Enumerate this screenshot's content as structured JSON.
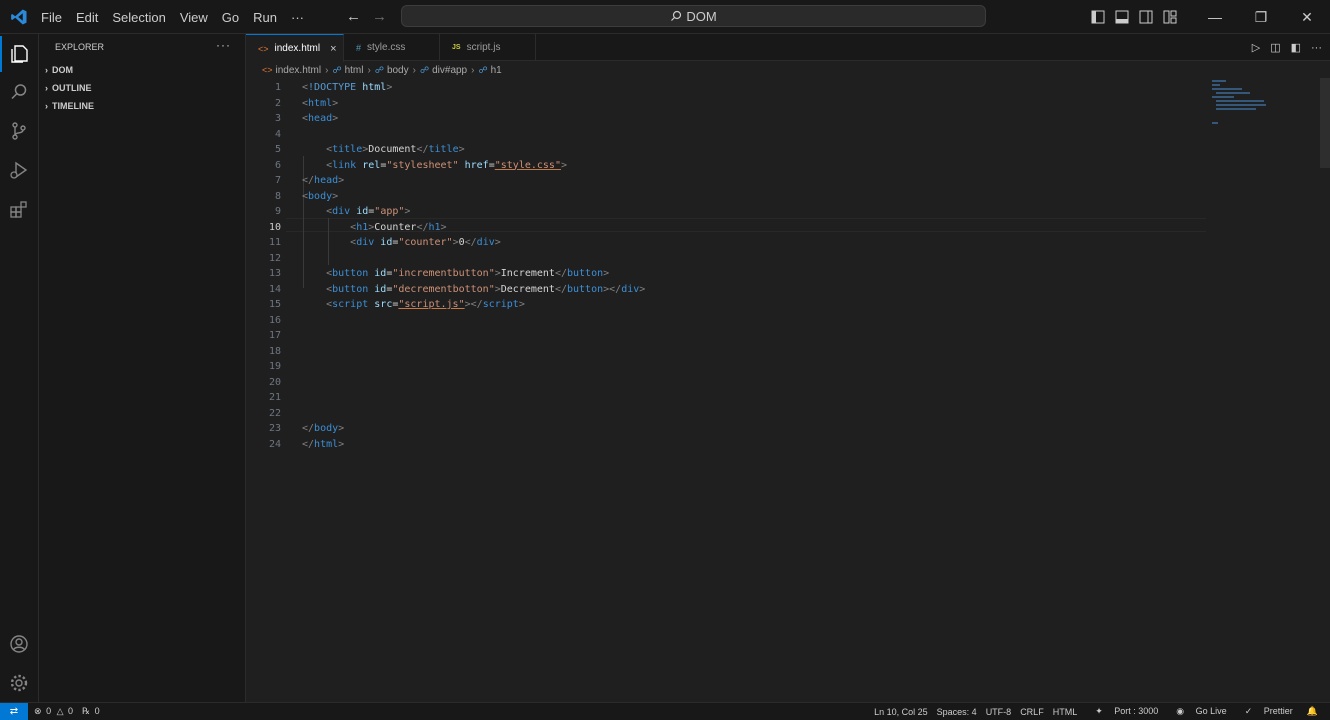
{
  "menu": [
    "File",
    "Edit",
    "Selection",
    "View",
    "Go",
    "Run",
    "···"
  ],
  "search": {
    "text": "DOM"
  },
  "sidebar": {
    "title": "EXPLORER",
    "more": "···",
    "sections": [
      "DOM",
      "OUTLINE",
      "TIMELINE"
    ]
  },
  "tabs": [
    {
      "label": "index.html",
      "icon": "<>",
      "icon_color": "#e37933"
    },
    {
      "label": "style.css",
      "icon": "#",
      "icon_color": "#519aba"
    },
    {
      "label": "script.js",
      "icon": "JS",
      "icon_color": "#cbcb41"
    }
  ],
  "tab_close": "×",
  "tab_actions": [
    "▷",
    "◫",
    "◧",
    "···"
  ],
  "breadcrumb": [
    "index.html",
    "html",
    "body",
    "div#app",
    "h1"
  ],
  "editor": {
    "current_line": 10,
    "lines": [
      {
        "n": "1",
        "t": [
          [
            "br",
            "<"
          ],
          [
            "doc",
            "!DOCTYPE"
          ],
          [
            "txt",
            " "
          ],
          [
            "attr",
            "html"
          ],
          [
            "br",
            ">"
          ]
        ]
      },
      {
        "n": "2",
        "t": [
          [
            "br",
            "<"
          ],
          [
            "tag",
            "html"
          ],
          [
            "br",
            ">"
          ]
        ]
      },
      {
        "n": "3",
        "t": [
          [
            "br",
            "<"
          ],
          [
            "tag",
            "head"
          ],
          [
            "br",
            ">"
          ]
        ]
      },
      {
        "n": "4",
        "t": []
      },
      {
        "n": "5",
        "t": [
          [
            "txt",
            "    "
          ],
          [
            "br",
            "<"
          ],
          [
            "tag",
            "title"
          ],
          [
            "br",
            ">"
          ],
          [
            "txt",
            "Document"
          ],
          [
            "br",
            "</"
          ],
          [
            "tag",
            "title"
          ],
          [
            "br",
            ">"
          ]
        ]
      },
      {
        "n": "6",
        "t": [
          [
            "txt",
            "    "
          ],
          [
            "br",
            "<"
          ],
          [
            "tag",
            "link"
          ],
          [
            "txt",
            " "
          ],
          [
            "attr",
            "rel"
          ],
          [
            "txt",
            "="
          ],
          [
            "str",
            "\"stylesheet\""
          ],
          [
            "txt",
            " "
          ],
          [
            "attr",
            "href"
          ],
          [
            "txt",
            "="
          ],
          [
            "strul",
            "\"style.css\""
          ],
          [
            "br",
            ">"
          ]
        ]
      },
      {
        "n": "7",
        "t": [
          [
            "br",
            "</"
          ],
          [
            "tag",
            "head"
          ],
          [
            "br",
            ">"
          ]
        ]
      },
      {
        "n": "8",
        "t": [
          [
            "br",
            "<"
          ],
          [
            "tag",
            "body"
          ],
          [
            "br",
            ">"
          ]
        ]
      },
      {
        "n": "9",
        "t": [
          [
            "txt",
            "    "
          ],
          [
            "br",
            "<"
          ],
          [
            "tag",
            "div"
          ],
          [
            "txt",
            " "
          ],
          [
            "attr",
            "id"
          ],
          [
            "txt",
            "="
          ],
          [
            "str",
            "\"app\""
          ],
          [
            "br",
            ">"
          ]
        ]
      },
      {
        "n": "10",
        "t": [
          [
            "txt",
            "        "
          ],
          [
            "br",
            "<"
          ],
          [
            "tag",
            "h1"
          ],
          [
            "br",
            ">"
          ],
          [
            "txt",
            "Counter"
          ],
          [
            "br",
            "</"
          ],
          [
            "tag",
            "h1"
          ],
          [
            "br",
            ">"
          ]
        ]
      },
      {
        "n": "11",
        "t": [
          [
            "txt",
            "        "
          ],
          [
            "br",
            "<"
          ],
          [
            "tag",
            "div"
          ],
          [
            "txt",
            " "
          ],
          [
            "attr",
            "id"
          ],
          [
            "txt",
            "="
          ],
          [
            "str",
            "\"counter\""
          ],
          [
            "br",
            ">"
          ],
          [
            "txt",
            "0"
          ],
          [
            "br",
            "</"
          ],
          [
            "tag",
            "div"
          ],
          [
            "br",
            ">"
          ]
        ]
      },
      {
        "n": "12",
        "t": []
      },
      {
        "n": "13",
        "t": [
          [
            "txt",
            "    "
          ],
          [
            "br",
            "<"
          ],
          [
            "tag",
            "button"
          ],
          [
            "txt",
            " "
          ],
          [
            "attr",
            "id"
          ],
          [
            "txt",
            "="
          ],
          [
            "str",
            "\"incrementbutton\""
          ],
          [
            "br",
            ">"
          ],
          [
            "txt",
            "Increment"
          ],
          [
            "br",
            "</"
          ],
          [
            "tag",
            "button"
          ],
          [
            "br",
            ">"
          ]
        ]
      },
      {
        "n": "14",
        "t": [
          [
            "txt",
            "    "
          ],
          [
            "br",
            "<"
          ],
          [
            "tag",
            "button"
          ],
          [
            "txt",
            " "
          ],
          [
            "attr",
            "id"
          ],
          [
            "txt",
            "="
          ],
          [
            "str",
            "\"decrementbotton\""
          ],
          [
            "br",
            ">"
          ],
          [
            "txt",
            "Decrement"
          ],
          [
            "br",
            "</"
          ],
          [
            "tag",
            "button"
          ],
          [
            "br",
            ">"
          ],
          [
            "br",
            "</"
          ],
          [
            "tag",
            "div"
          ],
          [
            "br",
            ">"
          ]
        ]
      },
      {
        "n": "15",
        "t": [
          [
            "txt",
            "    "
          ],
          [
            "br",
            "<"
          ],
          [
            "tag",
            "script"
          ],
          [
            "txt",
            " "
          ],
          [
            "attr",
            "src"
          ],
          [
            "txt",
            "="
          ],
          [
            "strul",
            "\"script.js\""
          ],
          [
            "br",
            ">"
          ],
          [
            "br",
            "</"
          ],
          [
            "tag",
            "script"
          ],
          [
            "br",
            ">"
          ]
        ]
      },
      {
        "n": "16",
        "t": []
      },
      {
        "n": "17",
        "t": []
      },
      {
        "n": "18",
        "t": []
      },
      {
        "n": "19",
        "t": []
      },
      {
        "n": "20",
        "t": []
      },
      {
        "n": "21",
        "t": []
      },
      {
        "n": "22",
        "t": []
      },
      {
        "n": "23",
        "t": [
          [
            "br",
            "</"
          ],
          [
            "tag",
            "body"
          ],
          [
            "br",
            ">"
          ]
        ]
      },
      {
        "n": "24",
        "t": [
          [
            "br",
            "</"
          ],
          [
            "tag",
            "html"
          ],
          [
            "br",
            ">"
          ]
        ]
      }
    ]
  },
  "status": {
    "errors": "0",
    "warnings": "0",
    "ports": "0",
    "position": "Ln 10, Col 25",
    "spaces": "Spaces: 4",
    "encoding": "UTF-8",
    "eol": "CRLF",
    "language": "HTML",
    "port": "Port : 3000",
    "golive": "Go Live",
    "prettier": "Prettier"
  },
  "colors": {
    "accent": "#0078d4",
    "background": "#1f1f1f",
    "sidebar": "#181818"
  }
}
